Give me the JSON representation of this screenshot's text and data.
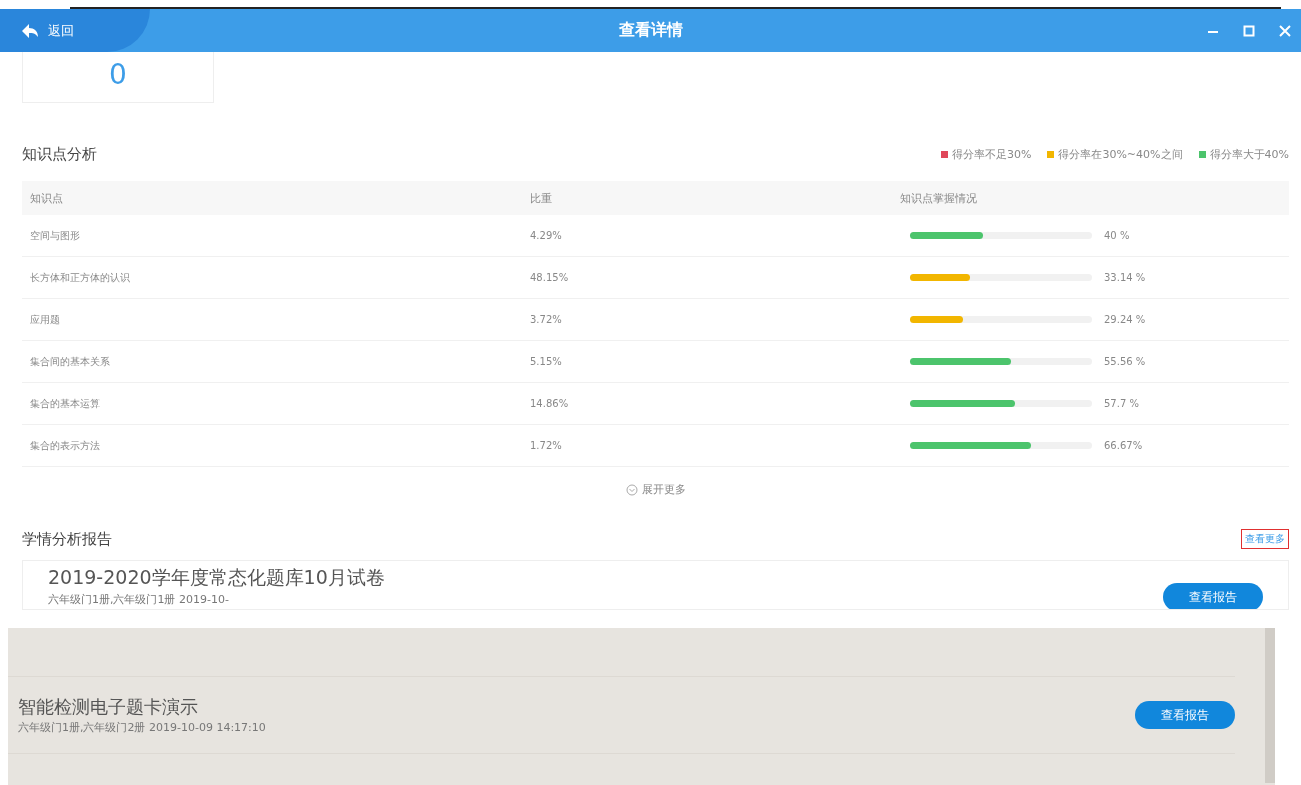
{
  "window": {
    "title": "查看详情",
    "back": "返回"
  },
  "stat": {
    "value": "0"
  },
  "knowledge": {
    "title": "知识点分析",
    "legend": [
      {
        "label": "得分率不足30%",
        "color": "#e0475a"
      },
      {
        "label": "得分率在30%~40%之间",
        "color": "#f2b600"
      },
      {
        "label": "得分率大于40%",
        "color": "#4cc46c"
      }
    ],
    "columns": [
      "知识点",
      "比重",
      "知识点掌握情况"
    ],
    "rows": [
      {
        "name": "空间与图形",
        "weight": "4.29%",
        "level": 0.4,
        "reading": "40 %",
        "color": "#4cc46c"
      },
      {
        "name": "长方体和正方体的认识",
        "weight": "48.15%",
        "level": 0.3314,
        "reading": "33.14 %",
        "color": "#f2b600"
      },
      {
        "name": "应用题",
        "weight": "3.72%",
        "level": 0.2924,
        "reading": "29.24 %",
        "color": "#f2b600"
      },
      {
        "name": "集合间的基本关系",
        "weight": "5.15%",
        "level": 0.5556,
        "reading": "55.56 %",
        "color": "#4cc46c"
      },
      {
        "name": "集合的基本运算",
        "weight": "14.86%",
        "level": 0.577,
        "reading": "57.7 %",
        "color": "#4cc46c"
      },
      {
        "name": "集合的表示方法",
        "weight": "1.72%",
        "level": 0.6667,
        "reading": "66.67%",
        "color": "#4cc46c"
      }
    ],
    "expand": "展开更多"
  },
  "reports": {
    "title": "学情分析报告",
    "more": "查看更多",
    "items": [
      {
        "title": "2019-2020学年度常态化题库10月试卷",
        "meta": "六年级门1册,六年级门1册  2019-10-",
        "button": "查看报告"
      },
      {
        "title": "智能检测电子题卡演示",
        "meta": "六年级门1册,六年级门2册  2019-10-09 14:17:10",
        "button": "查看报告"
      }
    ]
  }
}
